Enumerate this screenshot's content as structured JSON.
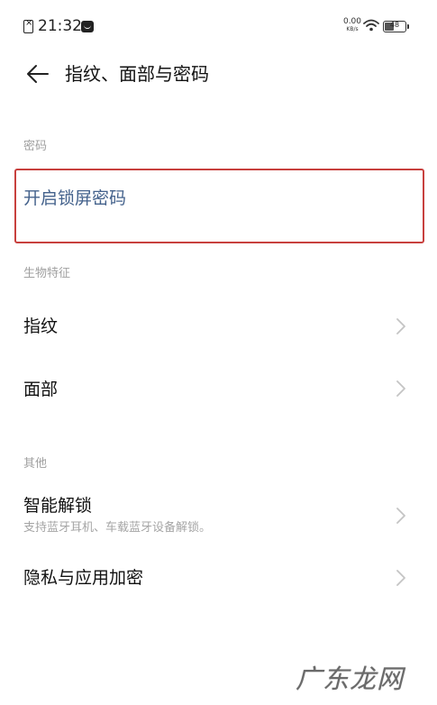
{
  "status_bar": {
    "time": "21:32",
    "net_speed_value": "0.00",
    "net_speed_unit": "KB/s",
    "battery_level": "48",
    "icons": [
      "sim-icon",
      "notification-icon",
      "wifi-icon",
      "battery-icon"
    ]
  },
  "header": {
    "title": "指纹、面部与密码",
    "back_icon": "arrow-left-icon"
  },
  "sections": {
    "password": {
      "header": "密码",
      "item_label": "开启锁屏密码",
      "accent_color": "#44628c",
      "highlight_color": "#c8403e"
    },
    "biometrics": {
      "header": "生物特征",
      "fingerprint_label": "指纹",
      "face_label": "面部"
    },
    "other": {
      "header": "其他",
      "smart_unlock_label": "智能解锁",
      "smart_unlock_desc": "支持蓝牙耳机、车载蓝牙设备解锁。",
      "privacy_label": "隐私与应用加密"
    }
  },
  "watermark": "广东龙网"
}
